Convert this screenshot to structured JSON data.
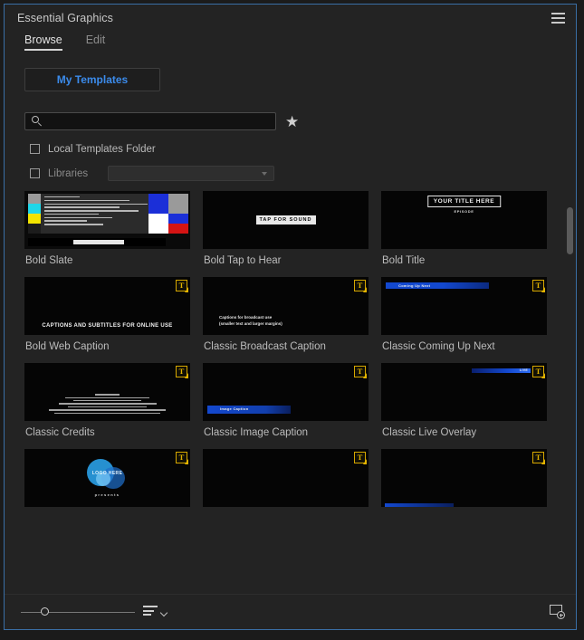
{
  "panel": {
    "title": "Essential Graphics",
    "menu_icon": "hamburger-menu-icon"
  },
  "tabs": [
    {
      "label": "Browse",
      "active": true
    },
    {
      "label": "Edit",
      "active": false
    }
  ],
  "toolbar": {
    "my_templates_label": "My Templates"
  },
  "search": {
    "value": "",
    "placeholder": "",
    "icon": "search-icon",
    "favorite_icon": "star-icon",
    "favorite_glyph": "★"
  },
  "filters": [
    {
      "label": "Local Templates Folder",
      "checked": false,
      "dim": false
    },
    {
      "label": "Libraries",
      "checked": false,
      "dim": true
    }
  ],
  "libraries_select": {
    "value": ""
  },
  "templates": [
    {
      "name": "Bold Slate",
      "art": "slate",
      "mogrt": false,
      "slate_bars": [
        "#9a9a9a",
        "#1fd6e8",
        "#f2e400",
        "#1c1c1c"
      ],
      "slate_quad": [
        "#1b2fd8",
        "#9a9a9a",
        "#ffffff",
        "#1b2fd8"
      ],
      "slate_quad2": [
        "#ffffff",
        "#d41414"
      ]
    },
    {
      "name": "Bold Tap to Hear",
      "art": "tap",
      "mogrt": false,
      "text": "TAP FOR SOUND"
    },
    {
      "name": "Bold Title",
      "art": "title",
      "mogrt": false,
      "text": "YOUR TITLE HERE",
      "subtext": "EPISODE"
    },
    {
      "name": "Bold Web Caption",
      "art": "web-caption",
      "mogrt": true,
      "text": "CAPTIONS AND SUBTITLES FOR ONLINE USE"
    },
    {
      "name": "Classic Broadcast Caption",
      "art": "broadcast-caption",
      "mogrt": true,
      "line1": "Captions for broadcast use",
      "line2": "(smaller text and larger margins)"
    },
    {
      "name": "Classic Coming Up Next",
      "art": "bar-upnext",
      "mogrt": true,
      "text": "Coming Up Next"
    },
    {
      "name": "Classic Credits",
      "art": "credits",
      "mogrt": true
    },
    {
      "name": "Classic Image Caption",
      "art": "bar-imgcap",
      "mogrt": true,
      "text": "Image Caption"
    },
    {
      "name": "Classic Live Overlay",
      "art": "bar-live",
      "mogrt": true,
      "text": "LIVE"
    },
    {
      "name": "",
      "art": "logo",
      "mogrt": true,
      "text": "LOGO HERE",
      "subtext": "presents"
    },
    {
      "name": "",
      "art": "blank",
      "mogrt": true
    },
    {
      "name": "",
      "art": "blank-bar",
      "mogrt": true
    }
  ],
  "footer": {
    "zoom_icon": "zoom-slider",
    "sort_icon": "sort-list-icon",
    "sort_chevron_icon": "chevron-down-icon",
    "install_icon": "install-template-icon"
  },
  "colors": {
    "accent_blue": "#3b8beb",
    "panel_bg": "#232323",
    "border_blue": "#3a6ea5",
    "mogrt_gold": "#e3b400"
  }
}
